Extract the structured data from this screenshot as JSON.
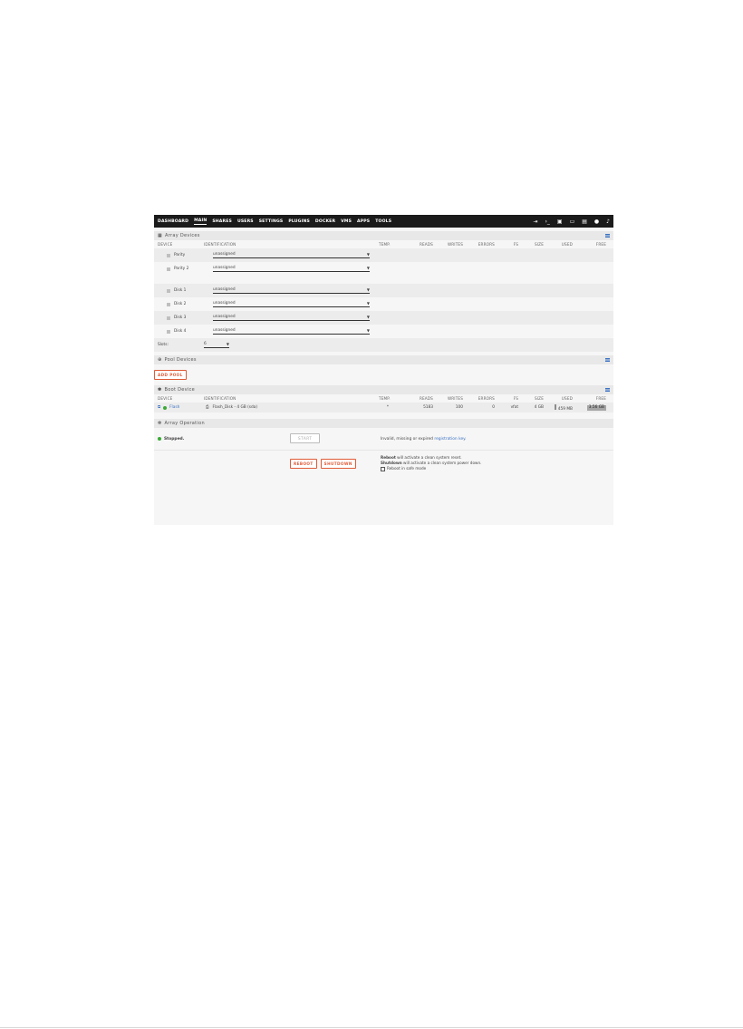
{
  "nav": {
    "items": [
      "DASHBOARD",
      "MAIN",
      "SHARES",
      "USERS",
      "SETTINGS",
      "PLUGINS",
      "DOCKER",
      "VMS",
      "APPS",
      "TOOLS"
    ],
    "active": "MAIN",
    "right_icons": [
      "logout-icon",
      "terminal-icon",
      "feedback-icon",
      "monitor-icon",
      "info-icon",
      "help-icon",
      "bell-icon"
    ]
  },
  "array_devices": {
    "title": "Array Devices",
    "columns": [
      "DEVICE",
      "IDENTIFICATION",
      "TEMP.",
      "READS",
      "WRITES",
      "ERRORS",
      "FS",
      "SIZE",
      "USED",
      "FREE"
    ],
    "rows": [
      {
        "device": "Parity",
        "identification": "unassigned"
      },
      {
        "device": "Parity 2",
        "identification": "unassigned"
      },
      {
        "device": "Disk 1",
        "identification": "unassigned"
      },
      {
        "device": "Disk 2",
        "identification": "unassigned"
      },
      {
        "device": "Disk 3",
        "identification": "unassigned"
      },
      {
        "device": "Disk 4",
        "identification": "unassigned"
      }
    ],
    "slots_label": "Slots:",
    "slots_value": "6"
  },
  "pool_devices": {
    "title": "Pool Devices",
    "add_pool_label": "ADD POOL"
  },
  "boot_device": {
    "title": "Boot Device",
    "columns": [
      "DEVICE",
      "IDENTIFICATION",
      "TEMP.",
      "READS",
      "WRITES",
      "ERRORS",
      "FS",
      "SIZE",
      "USED",
      "FREE"
    ],
    "row": {
      "device": "Flash",
      "identification": "Flash_Disk - 4 GB (sda)",
      "temp": "*",
      "reads": "5183",
      "writes": "100",
      "errors": "0",
      "fs": "vfat",
      "size": "4 GB",
      "used": "459 MB",
      "free": "3.56 GB"
    }
  },
  "array_operation": {
    "title": "Array Operation",
    "status": "Stopped.",
    "start_label": "START",
    "start_note_prefix": "Invalid, missing or expired ",
    "start_note_link": "registration key",
    "start_note_suffix": ".",
    "reboot_label": "REBOOT",
    "shutdown_label": "SHUTDOWN",
    "reboot_note_bold": "Reboot",
    "reboot_note_rest": " will activate a clean system reset.",
    "shutdown_note_bold": "Shutdown",
    "shutdown_note_rest": " will activate a clean system power down.",
    "safe_mode_label": "Reboot in safe mode"
  },
  "colors": {
    "nav_bg": "#1c1b1b",
    "accent": "#e05a36",
    "status_green": "#3aaa35",
    "link": "#3b72c4"
  }
}
